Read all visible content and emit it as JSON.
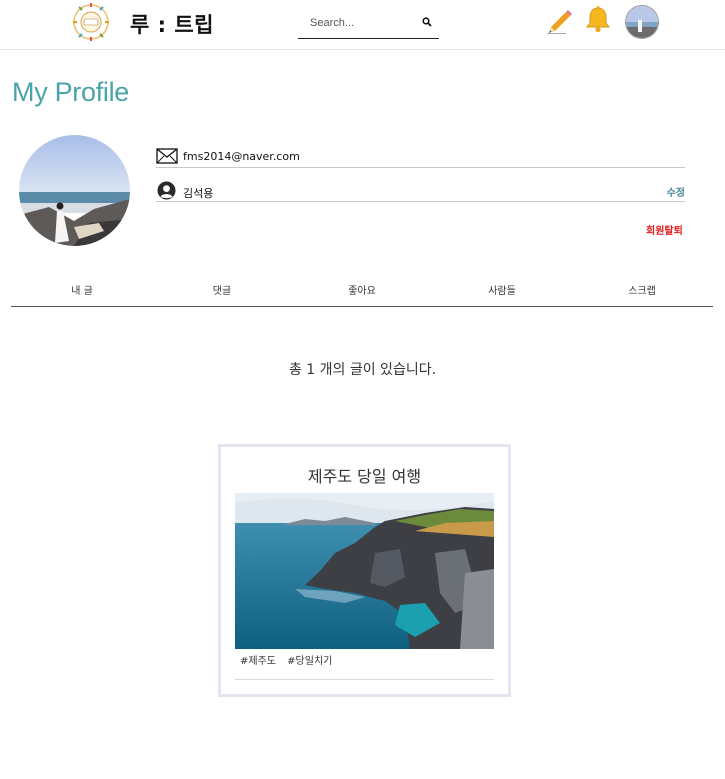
{
  "header": {
    "brand": "루 : 트립",
    "search_placeholder": "Search...",
    "icons": [
      "logo-icon",
      "search-icon",
      "pencil-icon",
      "bell-icon",
      "avatar"
    ]
  },
  "profile": {
    "title": "My Profile",
    "email": "fms2014@naver.com",
    "name": "김석용",
    "edit_label": "수정",
    "withdraw_label": "회원탈퇴"
  },
  "tabs": [
    {
      "label": "내 글"
    },
    {
      "label": "댓글"
    },
    {
      "label": "좋아요"
    },
    {
      "label": "사람들"
    },
    {
      "label": "스크랩"
    }
  ],
  "posts": {
    "count_text": "총 1 개의 글이 있습니다.",
    "items": [
      {
        "title": "제주도 당일 여행",
        "tags": [
          "#제주도",
          "#당일치기"
        ]
      }
    ]
  },
  "colors": {
    "title": "#4aa3a9",
    "edit": "#4a8a9a",
    "withdraw": "#e02020",
    "card_border": "#e5e5f2"
  }
}
